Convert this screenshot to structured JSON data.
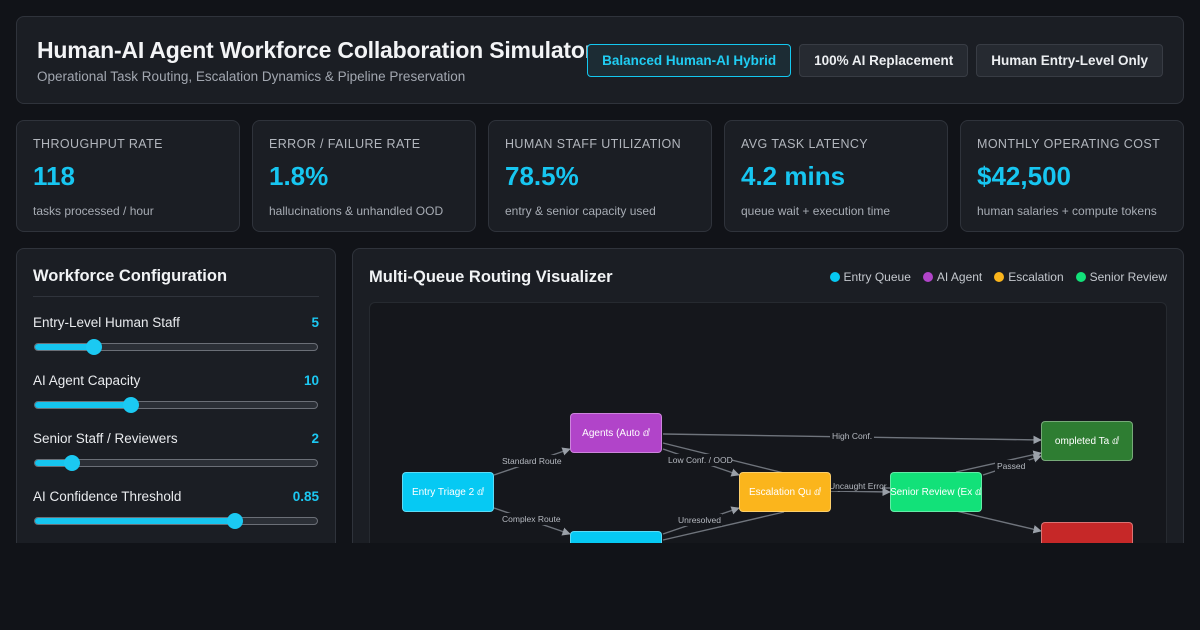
{
  "header": {
    "title": "Human-AI Agent Workforce Collaboration Simulator",
    "subtitle": "Operational Task Routing, Escalation Dynamics & Pipeline Preservation",
    "scenarios": [
      {
        "label": "Balanced Human-AI Hybrid",
        "active": true
      },
      {
        "label": "100% AI Replacement",
        "active": false
      },
      {
        "label": "Human Entry-Level Only",
        "active": false
      }
    ]
  },
  "kpis": [
    {
      "label": "THROUGHPUT RATE",
      "value": "118",
      "sub": "tasks processed / hour"
    },
    {
      "label": "ERROR / FAILURE RATE",
      "value": "1.8%",
      "sub": "hallucinations & unhandled OOD"
    },
    {
      "label": "HUMAN STAFF UTILIZATION",
      "value": "78.5%",
      "sub": "entry & senior capacity used"
    },
    {
      "label": "AVG TASK LATENCY",
      "value": "4.2 mins",
      "sub": "queue wait + execution time"
    },
    {
      "label": "MONTHLY OPERATING COST",
      "value": "$42,500",
      "sub": "human salaries + compute tokens"
    }
  ],
  "config": {
    "title": "Workforce Configuration",
    "controls": [
      {
        "label": "Entry-Level Human Staff",
        "value": "5",
        "fill": 0.21
      },
      {
        "label": "AI Agent Capacity",
        "value": "10",
        "fill": 0.34
      },
      {
        "label": "Senior Staff / Reviewers",
        "value": "2",
        "fill": 0.13
      },
      {
        "label": "AI Confidence Threshold",
        "value": "0.85",
        "fill": 0.71
      }
    ]
  },
  "viz": {
    "title": "Multi-Queue Routing Visualizer",
    "legend": [
      {
        "label": "Entry Queue",
        "color": "#06c9f3"
      },
      {
        "label": "AI Agent",
        "color": "#b144c9"
      },
      {
        "label": "Escalation",
        "color": "#fbb51c"
      },
      {
        "label": "Senior Review",
        "color": "#12e179"
      }
    ],
    "nodes": {
      "entry": {
        "label": "Entry Triage 2 ⅆ",
        "color": "#06c9f3"
      },
      "ai": {
        "label": "Agents (Auto ⅆ",
        "color": "#b144c9"
      },
      "human": {
        "label": "",
        "color": "#06c9f3"
      },
      "escalation": {
        "label": "Escalation Qu ⅆ",
        "color": "#fbb51c"
      },
      "senior": {
        "label": "Senior Review (Ex ⅆ",
        "color": "#12e179"
      },
      "completed": {
        "label": "ompleted Ta ⅆ",
        "color": "#2e7d32"
      },
      "failed": {
        "label": "",
        "color": "#c62828"
      }
    },
    "edges": {
      "standard": "Standard Route",
      "complex": "Complex Route",
      "high_conf": "High Conf.",
      "low_conf": "Low Conf. / OOD",
      "unresolved": "Unresolved",
      "uncaught": "Uncaught Error",
      "passed": "Passed"
    }
  }
}
